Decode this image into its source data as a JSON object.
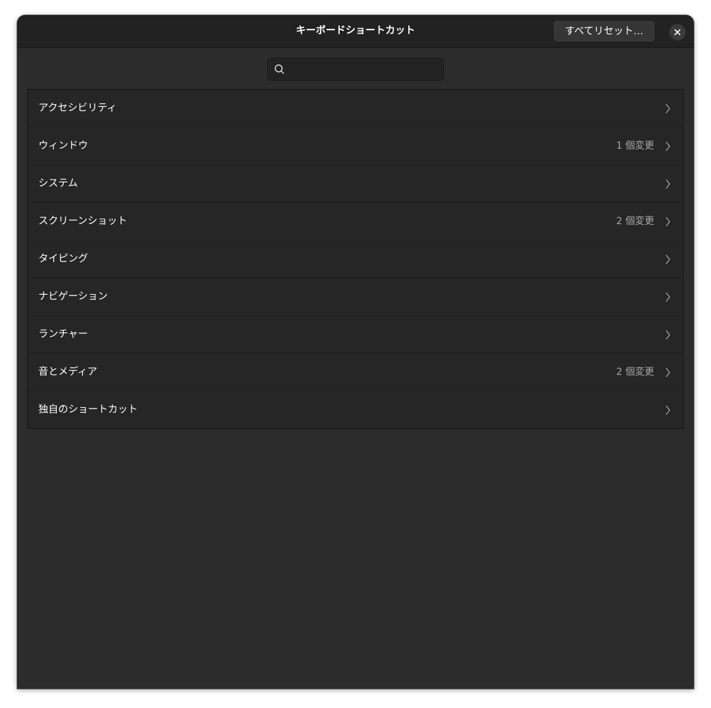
{
  "window": {
    "title": "キーボードショートカット",
    "reset_all_label": "すべてリセット…"
  },
  "search": {
    "value": "",
    "placeholder": ""
  },
  "categories": [
    {
      "label": "アクセシビリティ",
      "changes": ""
    },
    {
      "label": "ウィンドウ",
      "changes": "1 個変更"
    },
    {
      "label": "システム",
      "changes": ""
    },
    {
      "label": "スクリーンショット",
      "changes": "2 個変更"
    },
    {
      "label": "タイピング",
      "changes": ""
    },
    {
      "label": "ナビゲーション",
      "changes": ""
    },
    {
      "label": "ランチャー",
      "changes": ""
    },
    {
      "label": "音とメディア",
      "changes": "2 個変更"
    },
    {
      "label": "独自のショートカット",
      "changes": ""
    }
  ]
}
